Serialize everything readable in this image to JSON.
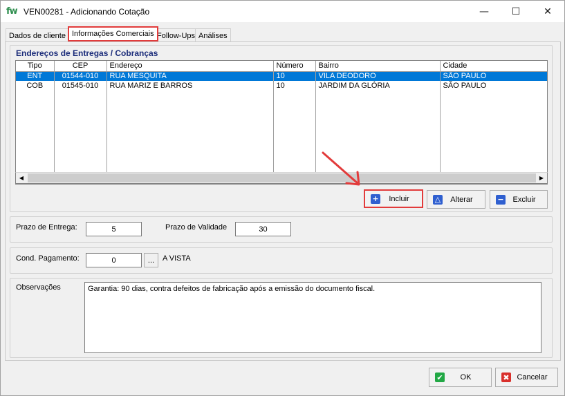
{
  "window": {
    "logo": "fw",
    "title": "VEN00281 - Adicionando Cotação",
    "controls": {
      "minimize": "—",
      "maximize": "☐",
      "close": "✕"
    }
  },
  "tabs": [
    {
      "label": "Dados de cliente",
      "active": false
    },
    {
      "label": "Informações Comerciais",
      "active": true
    },
    {
      "label": "Follow-Ups",
      "active": false
    },
    {
      "label": "Análises",
      "active": false
    }
  ],
  "addresses": {
    "title": "Endereços de Entregas / Cobranças",
    "columns": [
      "Tipo",
      "CEP",
      "Endereço",
      "Número",
      "Bairro",
      "Cidade"
    ],
    "rows": [
      {
        "tipo": "ENT",
        "cep": "01544-010",
        "endereco": "RUA MESQUITA",
        "numero": "10",
        "bairro": "VILA DEODORO",
        "cidade": "SÃO PAULO",
        "selected": true
      },
      {
        "tipo": "COB",
        "cep": "01545-010",
        "endereco": "RUA MARIZ E BARROS",
        "numero": "10",
        "bairro": "JARDIM DA GLÓRIA",
        "cidade": "SÃO PAULO",
        "selected": false
      }
    ],
    "scroll_left": "◀",
    "scroll_right": "▶"
  },
  "buttons": {
    "incluir": {
      "label": "Incluir",
      "icon": "+",
      "icon_name": "plus-icon",
      "color": "#2f5fd0"
    },
    "alterar": {
      "label": "Alterar",
      "icon": "△",
      "icon_name": "triangle-up-icon",
      "color": "#2f5fd0"
    },
    "excluir": {
      "label": "Excluir",
      "icon": "−",
      "icon_name": "minus-icon",
      "color": "#2f5fd0"
    },
    "ok": {
      "label": "OK",
      "icon": "✔",
      "icon_name": "check-icon",
      "color": "#22a845"
    },
    "cancelar": {
      "label": "Cancelar",
      "icon": "✖",
      "icon_name": "x-icon",
      "color": "#d9302c"
    }
  },
  "prazos": {
    "entrega_label": "Prazo de Entrega:",
    "entrega_value": "5",
    "validade_label": "Prazo de Validade",
    "validade_value": "30"
  },
  "pagamento": {
    "label": "Cond. Pagamento:",
    "value": "0",
    "lookup": "...",
    "description": "A VISTA"
  },
  "observacoes": {
    "label": "Observações",
    "value": "Garantia: 90 dias, contra defeitos de fabricação após a emissão do documento fiscal."
  },
  "colors": {
    "highlight": "#e23b3b",
    "selection": "#0078d7",
    "group_title": "#1b2c7a"
  }
}
